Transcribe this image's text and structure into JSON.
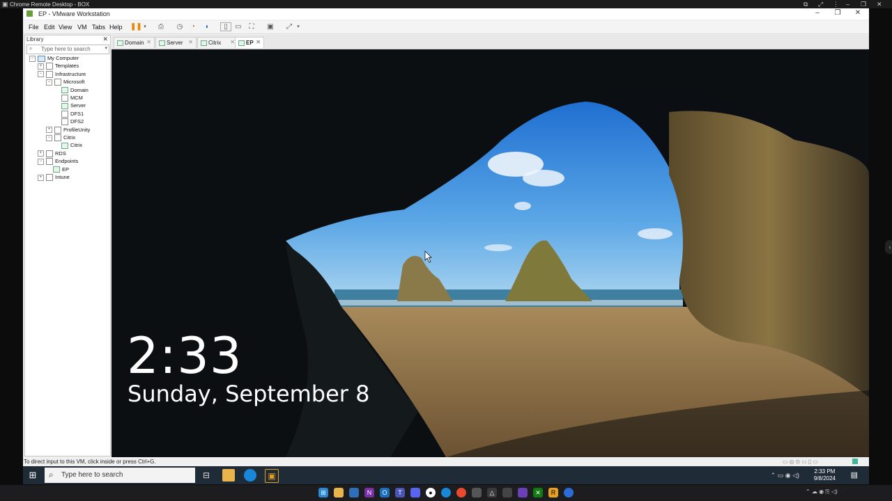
{
  "crd": {
    "title": "Chrome Remote Desktop - BOX"
  },
  "vmware": {
    "title": "EP - VMware Workstation",
    "menu": [
      "File",
      "Edit",
      "View",
      "VM",
      "Tabs",
      "Help"
    ],
    "library": {
      "title": "Library",
      "search_placeholder": "Type here to search",
      "tree": [
        {
          "label": "My Computer",
          "level": 0,
          "expand": "−",
          "icon": "computer"
        },
        {
          "label": "Templates",
          "level": 1,
          "expand": "+",
          "icon": "folder"
        },
        {
          "label": "Infrastructure",
          "level": 1,
          "expand": "−",
          "icon": "folder"
        },
        {
          "label": "Microsoft",
          "level": 2,
          "expand": "−",
          "icon": "folder"
        },
        {
          "label": "Domain",
          "level": 3,
          "expand": "",
          "icon": "vm"
        },
        {
          "label": "MCM",
          "level": 3,
          "expand": "",
          "icon": "vm-off"
        },
        {
          "label": "Server",
          "level": 3,
          "expand": "",
          "icon": "vm"
        },
        {
          "label": "DFS1",
          "level": 3,
          "expand": "",
          "icon": "vm-off"
        },
        {
          "label": "DFS2",
          "level": 3,
          "expand": "",
          "icon": "vm-off"
        },
        {
          "label": "ProfileUnity",
          "level": 2,
          "expand": "+",
          "icon": "folder"
        },
        {
          "label": "Citrix",
          "level": 2,
          "expand": "−",
          "icon": "folder"
        },
        {
          "label": "Citrix",
          "level": 3,
          "expand": "",
          "icon": "vm"
        },
        {
          "label": "RDS",
          "level": 1,
          "expand": "+",
          "icon": "folder"
        },
        {
          "label": "Endpoints",
          "level": 1,
          "expand": "−",
          "icon": "folder"
        },
        {
          "label": "EP",
          "level": 2,
          "expand": "",
          "icon": "vm"
        },
        {
          "label": "Intune",
          "level": 1,
          "expand": "+",
          "icon": "folder"
        }
      ]
    },
    "tabs": [
      {
        "label": "Domain",
        "active": false
      },
      {
        "label": "Server",
        "active": false
      },
      {
        "label": "Citrix",
        "active": false
      },
      {
        "label": "EP",
        "active": true
      }
    ],
    "status_text": "To direct input to this VM, click inside or press Ctrl+G."
  },
  "lockscreen": {
    "time": "2:33",
    "date": "Sunday, September 8"
  },
  "guest_taskbar": {
    "search_placeholder": "Type here to search",
    "time": "2:33 PM",
    "date": "9/8/2024"
  },
  "colors": {
    "accent": "#0a64c8",
    "taskbar": "#202b38",
    "host_taskbar": "#1d1d1f"
  }
}
